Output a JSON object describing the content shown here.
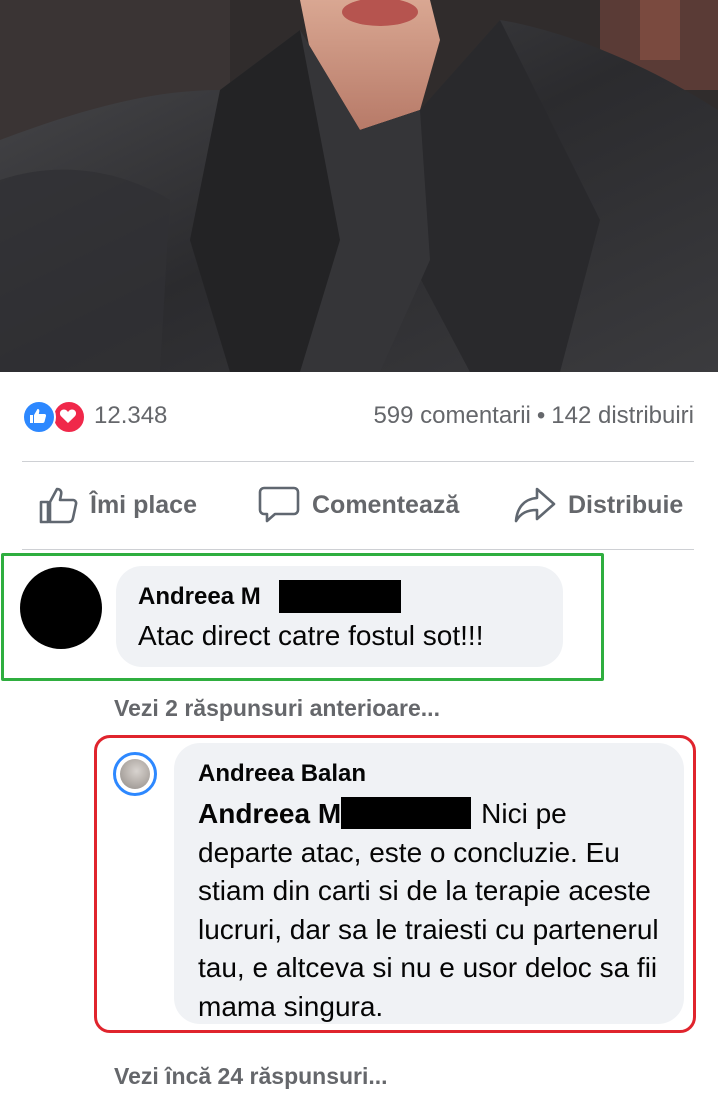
{
  "post": {
    "reactions": {
      "count": "12.348",
      "icons": [
        "like-icon",
        "love-icon"
      ]
    },
    "comments_count": "599 comentarii",
    "shares_count": "142 distribuiri",
    "separator": "•"
  },
  "actions": {
    "like": "Îmi place",
    "comment": "Comentează",
    "share": "Distribuie"
  },
  "comment": {
    "author": "Andreea M",
    "text": "Atac direct catre fostul sot!!!"
  },
  "view_previous": "Vezi 2 răspunsuri anterioare...",
  "reply": {
    "author": "Andreea Balan",
    "mention": "Andreea M",
    "text": "Nici pe departe atac, este o concluzie. Eu stiam din carti si de la terapie aceste lucruri, dar sa le traiesti cu partenerul tau, e altceva si nu e usor deloc sa fii mama singura."
  },
  "view_more": "Vezi încă 24 răspunsuri...",
  "colors": {
    "like_blue": "#2d88ff",
    "love_red": "#f0284a",
    "highlight_green": "#2fae3f",
    "highlight_red": "#e0242d",
    "bubble_gray": "#f0f2f5"
  }
}
